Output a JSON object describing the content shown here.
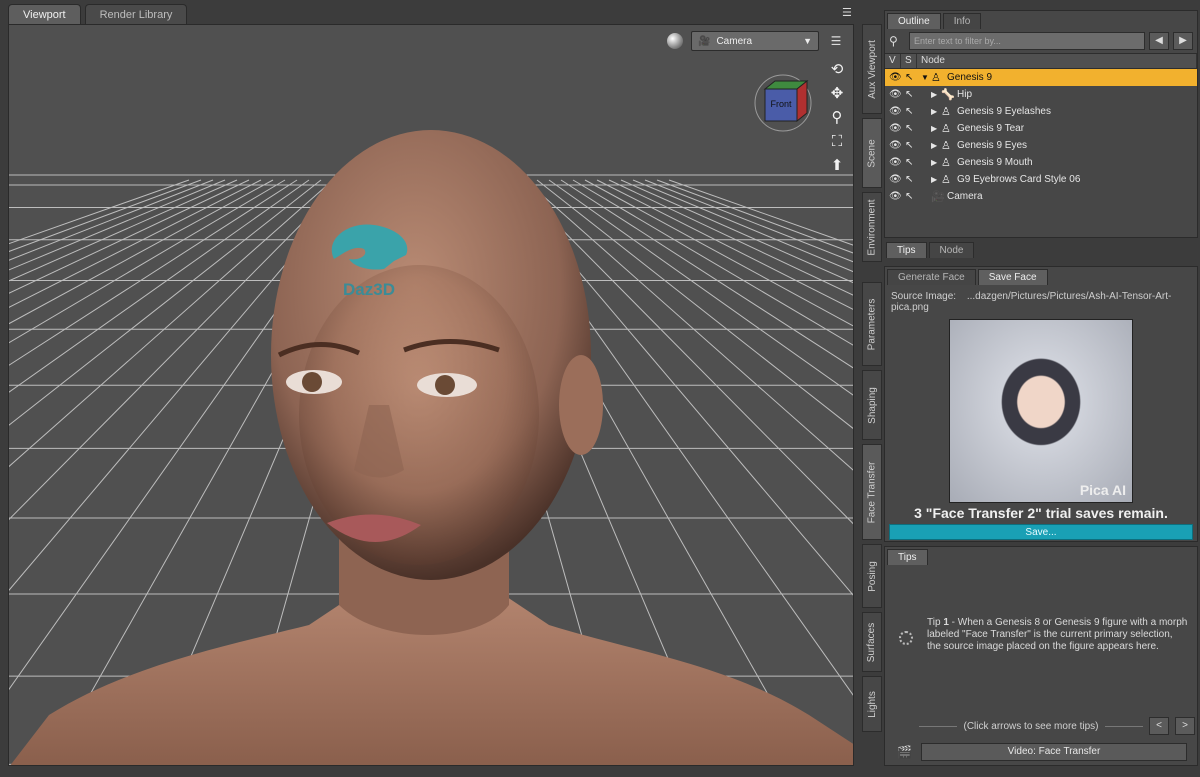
{
  "viewport_tabs": [
    {
      "label": "Viewport",
      "active": true
    },
    {
      "label": "Render Library",
      "active": false
    }
  ],
  "viewport": {
    "camera_label": "Camera",
    "cube_label": "Front",
    "logo_text": "Daz3D",
    "tool_icons": [
      "orbit-icon",
      "pan-icon",
      "zoom-icon",
      "frame-icon",
      "reset-icon"
    ]
  },
  "side_tabs": [
    "Aux Viewport",
    "Scene",
    "Environment",
    "Parameters",
    "Shaping",
    "Face Transfer",
    "Posing",
    "Surfaces",
    "Lights"
  ],
  "outline": {
    "tabs": [
      "Outline",
      "Info"
    ],
    "filter_placeholder": "Enter text to filter by...",
    "headers": {
      "v": "V",
      "s": "S",
      "node": "Node"
    },
    "nodes": [
      {
        "label": "Genesis 9",
        "level": 0,
        "expanded": true,
        "selected": true,
        "icon": "figure-icon"
      },
      {
        "label": "Hip",
        "level": 1,
        "expanded": false,
        "selected": false,
        "icon": "bone-icon"
      },
      {
        "label": "Genesis 9 Eyelashes",
        "level": 1,
        "expanded": false,
        "selected": false,
        "icon": "figure-icon"
      },
      {
        "label": "Genesis 9 Tear",
        "level": 1,
        "expanded": false,
        "selected": false,
        "icon": "figure-icon"
      },
      {
        "label": "Genesis 9 Eyes",
        "level": 1,
        "expanded": false,
        "selected": false,
        "icon": "figure-icon"
      },
      {
        "label": "Genesis 9 Mouth",
        "level": 1,
        "expanded": false,
        "selected": false,
        "icon": "figure-icon"
      },
      {
        "label": "G9 Eyebrows Card Style 06",
        "level": 1,
        "expanded": false,
        "selected": false,
        "icon": "figure-icon"
      },
      {
        "label": "Camera",
        "level": 0,
        "expanded": null,
        "selected": false,
        "icon": "camera-icon"
      }
    ],
    "bottom_tabs": [
      "Tips",
      "Node"
    ]
  },
  "face_transfer": {
    "tabs": [
      "Generate Face",
      "Save Face"
    ],
    "source_label": "Source Image:",
    "source_path": "...dazgen/Pictures/Pictures/Ash-AI-Tensor-Art-pica.png",
    "watermark": "Pica AI",
    "message": "3 \"Face Transfer 2\" trial saves remain.",
    "save_button": "Save..."
  },
  "tips": {
    "tab": "Tips",
    "tip_prefix": "Tip ",
    "tip_number": "1",
    "tip_text": " - When a Genesis 8 or Genesis 9 figure with a morph labeled \"Face Transfer\" is the current primary selection, the source image placed on the figure appears here.",
    "nav_text": "(Click arrows to see more tips)",
    "video_button": "Video: Face Transfer"
  },
  "colors": {
    "selection": "#f2b12e",
    "accent": "#19a0b5",
    "logo": "#3aa3aa"
  }
}
